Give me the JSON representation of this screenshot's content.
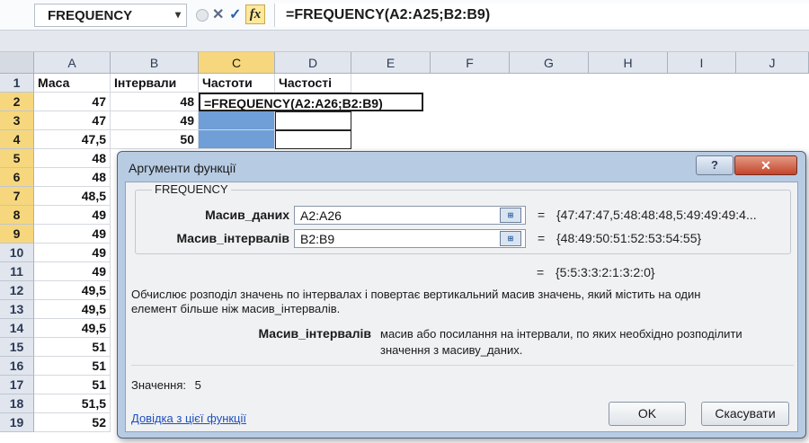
{
  "formula_bar": {
    "name_box": "FREQUENCY",
    "name_box_dropdown": "▾",
    "cancel_symbol": "✕",
    "enter_symbol": "✓",
    "fx_label": "fx",
    "formula": "=FREQUENCY(A2:A25;B2:B9)"
  },
  "grid": {
    "columns": [
      "A",
      "B",
      "C",
      "D",
      "E",
      "F",
      "G",
      "H",
      "I",
      "J"
    ],
    "selected_column": "C",
    "rows": [
      "1",
      "2",
      "3",
      "4",
      "5",
      "6",
      "7",
      "8",
      "9",
      "10",
      "11",
      "12",
      "13",
      "14",
      "15",
      "16",
      "17",
      "18",
      "19"
    ],
    "headers": {
      "a": "Маса",
      "b": "Інтервали",
      "c": "Частоти",
      "d": "Частості"
    },
    "col_a": [
      "47",
      "47",
      "47,5",
      "48",
      "48",
      "48,5",
      "49",
      "49",
      "49",
      "49",
      "49,5",
      "49,5",
      "49,5",
      "51",
      "51",
      "51",
      "51,5",
      "52"
    ],
    "col_b": [
      "48",
      "49",
      "50"
    ],
    "editing_formula": "=FREQUENCY(A2:A26;B2:B9)"
  },
  "dialog": {
    "title": "Аргументи функції",
    "help_button": "?",
    "close_button": "✕",
    "function_name": "FREQUENCY",
    "args": [
      {
        "label": "Масив_даних",
        "value": "A2:A26",
        "result": "{47:47:47,5:48:48:48,5:49:49:49:4..."
      },
      {
        "label": "Масив_інтервалів",
        "value": "B2:B9",
        "result": "{48:49:50:51:52:53:54:55}"
      }
    ],
    "ref_button_icon": "range-select-icon",
    "equals": "=",
    "formula_result": "{5:5:3:3:2:1:3:2:0}",
    "description_line1": "Обчислює розподіл значень по інтервалах і повертає вертикальний масив значень, який містить на один",
    "description_line2": "елемент більше ніж масив_інтервалів.",
    "param_name": "Масив_інтервалів",
    "param_desc_line1": "масив або посилання на інтервали, по яких необхідно розподілити",
    "param_desc_line2": "значення з масиву_даних.",
    "result_label": "Значення:",
    "result_value": "5",
    "help_link": "Довідка з цієї функції",
    "ok_label": "OK",
    "cancel_label": "Скасувати"
  }
}
